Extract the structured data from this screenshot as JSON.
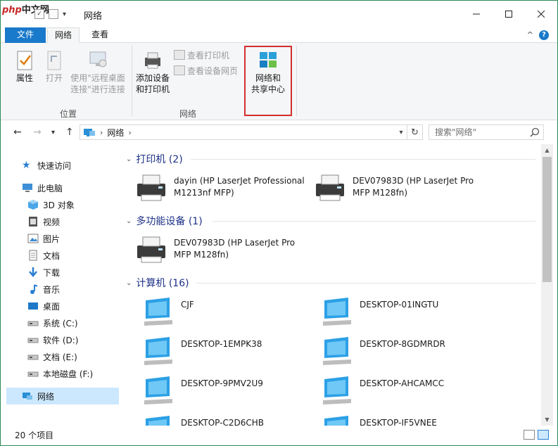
{
  "watermark": "php中文网",
  "window": {
    "title": "网络"
  },
  "tabs": {
    "file": "文件",
    "network": "网络",
    "view": "查看"
  },
  "ribbon": {
    "properties": "属性",
    "open": "打开",
    "remote_line1": "使用\"远程桌面",
    "remote_line2": "连接\"进行连接",
    "add_device_line1": "添加设备",
    "add_device_line2": "和打印机",
    "view_printers": "查看打印机",
    "view_webpage": "查看设备网页",
    "nsc_line1": "网络和",
    "nsc_line2": "共享中心",
    "group_location": "位置",
    "group_network": "网络"
  },
  "address": {
    "path": "网络",
    "search_placeholder": "搜索\"网络\""
  },
  "sidebar": {
    "quick_access": "快速访问",
    "this_pc": "此电脑",
    "items": [
      {
        "label": "3D 对象",
        "icon": "cube-icon"
      },
      {
        "label": "视频",
        "icon": "video-icon"
      },
      {
        "label": "图片",
        "icon": "picture-icon"
      },
      {
        "label": "文档",
        "icon": "document-icon"
      },
      {
        "label": "下载",
        "icon": "download-icon"
      },
      {
        "label": "音乐",
        "icon": "music-icon"
      },
      {
        "label": "桌面",
        "icon": "desktop-icon"
      },
      {
        "label": "系统 (C:)",
        "icon": "drive-icon"
      },
      {
        "label": "软件 (D:)",
        "icon": "drive-icon"
      },
      {
        "label": "文档 (E:)",
        "icon": "drive-icon"
      },
      {
        "label": "本地磁盘 (F:)",
        "icon": "drive-icon"
      }
    ],
    "network": "网络"
  },
  "groups": {
    "printers": "打印机 (2)",
    "mfp": "多功能设备 (1)",
    "computers": "计算机 (16)"
  },
  "printers": [
    {
      "line1": "dayin (HP LaserJet Professional",
      "line2": "M1213nf MFP)"
    },
    {
      "line1": "DEV07983D (HP LaserJet Pro",
      "line2": "MFP M128fn)"
    }
  ],
  "mfp": [
    {
      "line1": "DEV07983D (HP LaserJet Pro",
      "line2": "MFP M128fn)"
    }
  ],
  "computers": [
    "CJF",
    "DESKTOP-01INGTU",
    "DESKTOP-1EMPK38",
    "DESKTOP-8GDMRDR",
    "DESKTOP-9PMV2U9",
    "DESKTOP-AHCAMCC",
    "DESKTOP-C2D6CHB",
    "DESKTOP-IF5VNEE"
  ],
  "status": {
    "count": "20 个项目"
  },
  "colors": {
    "accent": "#1979ca",
    "selection": "#cce8ff",
    "group_header": "#1e3287",
    "highlight_box": "#d32f2f"
  }
}
